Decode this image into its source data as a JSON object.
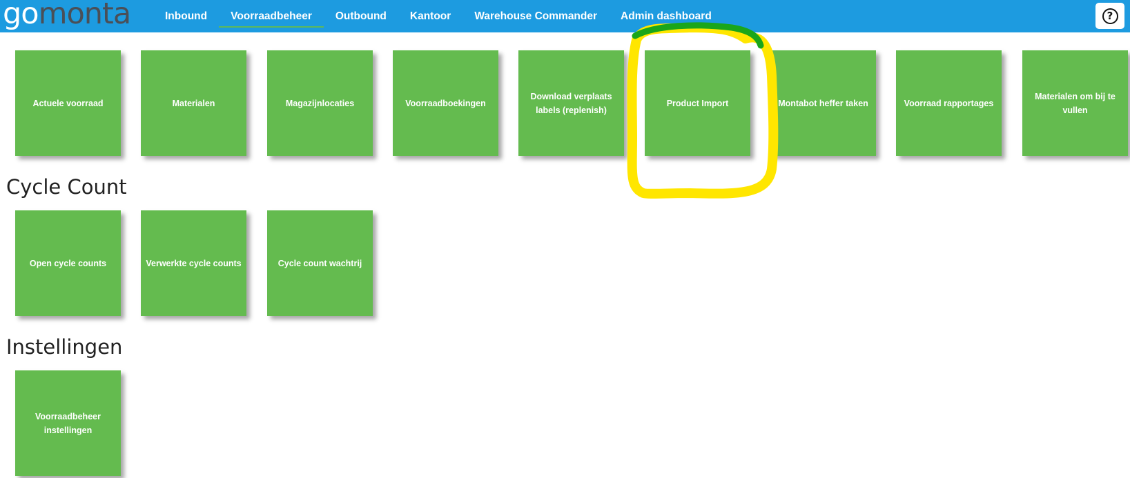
{
  "logo": {
    "part1": "go",
    "part2": "monta"
  },
  "nav": {
    "items": [
      {
        "label": "Inbound"
      },
      {
        "label": "Voorraadbeheer",
        "active": true
      },
      {
        "label": "Outbound"
      },
      {
        "label": "Kantoor"
      },
      {
        "label": "Warehouse Commander"
      },
      {
        "label": "Admin dashboard"
      }
    ]
  },
  "help": {
    "icon": "question-circle-icon",
    "symbol": "?"
  },
  "main": {
    "tiles": [
      "Actuele voorraad",
      "Materialen",
      "Magazijnlocaties",
      "Voorraadboekingen",
      "Download verplaats labels (replenish)",
      "Product Import",
      "Montabot heffer taken",
      "Voorraad rapportages",
      "Materialen om bij te vullen"
    ]
  },
  "sections": [
    {
      "title": "Cycle Count",
      "tiles": [
        "Open cycle counts",
        "Verwerkte cycle counts",
        "Cycle count wachtrij"
      ]
    },
    {
      "title": "Instellingen",
      "tiles": [
        "Voorraadbeheer instellingen"
      ]
    }
  ],
  "colors": {
    "topbar": "#1d9be0",
    "tile": "#64bb4f",
    "highlight": "#ffe600",
    "highlight_top": "#1aa61a"
  }
}
